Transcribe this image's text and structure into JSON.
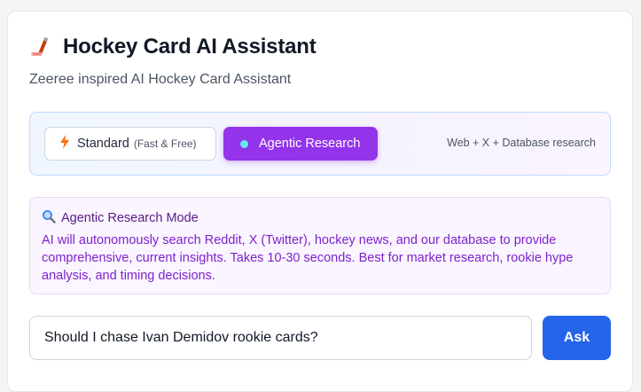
{
  "header": {
    "title_icon": "hockey-stick-icon",
    "title": "Hockey Card AI Assistant",
    "subtitle": "Zeeree inspired AI Hockey Card Assistant"
  },
  "modes": {
    "standard": {
      "icon": "lightning-icon",
      "label": "Standard",
      "sub_label": "(Fast & Free)",
      "selected": false
    },
    "agentic": {
      "icon": "dot-icon",
      "label": "Agentic Research",
      "selected": true
    },
    "hint": "Web + X + Database research"
  },
  "info": {
    "icon": "magnifier-icon",
    "title": "Agentic Research Mode",
    "body": "AI will autonomously search Reddit, X (Twitter), hockey news, and our database to provide comprehensive, current insights. Takes 10-30 seconds. Best for market research, rookie hype analysis, and timing decisions."
  },
  "query": {
    "value": "Should I chase Ivan Demidov rookie cards?",
    "button_label": "Ask"
  },
  "colors": {
    "accent_purple": "#9333ea",
    "ask_blue": "#2563eb",
    "info_text": "#7e22ce"
  }
}
